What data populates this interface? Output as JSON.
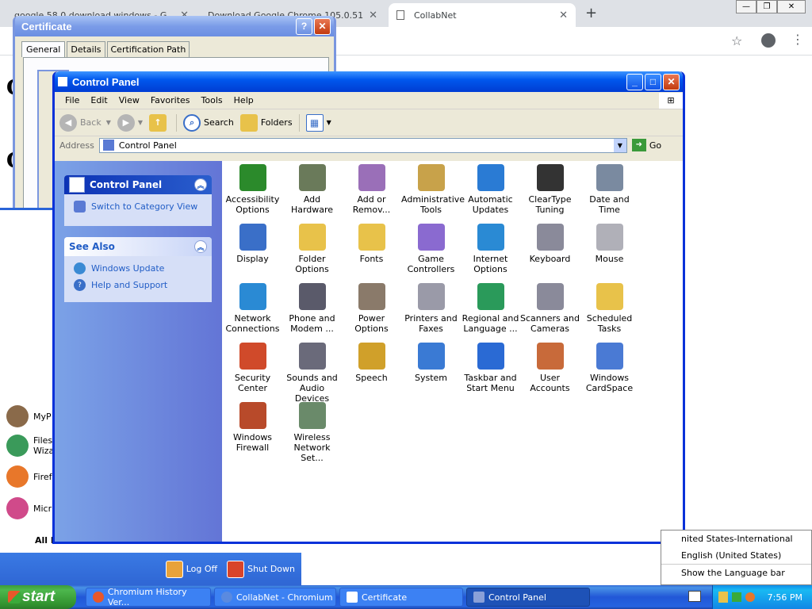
{
  "chrome": {
    "tabs": [
      {
        "label": "google 58.0 download windows - G"
      },
      {
        "label": "Download Google Chrome 105.0.51"
      },
      {
        "label": "CollabNet"
      }
    ],
    "new_tab": "+",
    "window_controls": [
      "—",
      "❐",
      "✕"
    ]
  },
  "certificate_window": {
    "title": "Certificate",
    "tabs": [
      "General",
      "Details",
      "Certification Path"
    ]
  },
  "control_panel": {
    "title": "Control Panel",
    "menu": [
      "File",
      "Edit",
      "View",
      "Favorites",
      "Tools",
      "Help"
    ],
    "toolbar": {
      "back": "Back",
      "search": "Search",
      "folders": "Folders"
    },
    "address_label": "Address",
    "address_value": "Control Panel",
    "go_label": "Go",
    "task_pane": {
      "panel_title": "Control Panel",
      "switch_link": "Switch to Category View",
      "see_also_title": "See Also",
      "see_also_links": [
        "Windows Update",
        "Help and Support"
      ]
    },
    "items": [
      {
        "line1": "Accessibility",
        "line2": "Options",
        "icon": "accessibility-icon",
        "color": "#2b8a2b"
      },
      {
        "line1": "Add Hardware",
        "line2": "",
        "icon": "add-hardware-icon",
        "color": "#6a7a5a"
      },
      {
        "line1": "Add or",
        "line2": "Remov...",
        "icon": "add-remove-icon",
        "color": "#9a6fb8"
      },
      {
        "line1": "Administrative",
        "line2": "Tools",
        "icon": "admin-tools-icon",
        "color": "#c8a24a"
      },
      {
        "line1": "Automatic",
        "line2": "Updates",
        "icon": "automatic-updates-icon",
        "color": "#2a7bd4"
      },
      {
        "line1": "ClearType",
        "line2": "Tuning",
        "icon": "cleartype-icon",
        "color": "#333333"
      },
      {
        "line1": "Date and Time",
        "line2": "",
        "icon": "clock-icon",
        "color": "#7a8aa0"
      },
      {
        "line1": "Display",
        "line2": "",
        "icon": "display-icon",
        "color": "#3a6fc8"
      },
      {
        "line1": "Folder Options",
        "line2": "",
        "icon": "folder-options-icon",
        "color": "#e8c24a"
      },
      {
        "line1": "Fonts",
        "line2": "",
        "icon": "fonts-folder-icon",
        "color": "#e8c24a"
      },
      {
        "line1": "Game",
        "line2": "Controllers",
        "icon": "gamepad-icon",
        "color": "#8a6ad0"
      },
      {
        "line1": "Internet",
        "line2": "Options",
        "icon": "internet-options-icon",
        "color": "#2a8ad4"
      },
      {
        "line1": "Keyboard",
        "line2": "",
        "icon": "keyboard-icon",
        "color": "#8a8a9a"
      },
      {
        "line1": "Mouse",
        "line2": "",
        "icon": "mouse-icon",
        "color": "#b0b0b8"
      },
      {
        "line1": "Network",
        "line2": "Connections",
        "icon": "network-icon",
        "color": "#2a8ad4"
      },
      {
        "line1": "Phone and",
        "line2": "Modem ...",
        "icon": "phone-icon",
        "color": "#5a5a6a"
      },
      {
        "line1": "Power Options",
        "line2": "",
        "icon": "power-icon",
        "color": "#8a7a6a"
      },
      {
        "line1": "Printers and",
        "line2": "Faxes",
        "icon": "printer-icon",
        "color": "#9a9aa8"
      },
      {
        "line1": "Regional and",
        "line2": "Language ...",
        "icon": "globe-icon",
        "color": "#2a9a5a"
      },
      {
        "line1": "Scanners and",
        "line2": "Cameras",
        "icon": "scanner-icon",
        "color": "#8a8a9a"
      },
      {
        "line1": "Scheduled",
        "line2": "Tasks",
        "icon": "scheduled-tasks-icon",
        "color": "#e8c24a"
      },
      {
        "line1": "Security",
        "line2": "Center",
        "icon": "shield-icon",
        "color": "#d04a2a"
      },
      {
        "line1": "Sounds and",
        "line2": "Audio Devices",
        "icon": "speaker-icon",
        "color": "#6a6a7a"
      },
      {
        "line1": "Speech",
        "line2": "",
        "icon": "speech-icon",
        "color": "#d0a02a"
      },
      {
        "line1": "System",
        "line2": "",
        "icon": "system-icon",
        "color": "#3a7ad4"
      },
      {
        "line1": "Taskbar and",
        "line2": "Start Menu",
        "icon": "taskbar-icon",
        "color": "#2a6ad4"
      },
      {
        "line1": "User Accounts",
        "line2": "",
        "icon": "user-accounts-icon",
        "color": "#c86a3a"
      },
      {
        "line1": "Windows",
        "line2": "CardSpace",
        "icon": "cardspace-icon",
        "color": "#4a7ad4"
      },
      {
        "line1": "Windows",
        "line2": "Firewall",
        "icon": "firewall-icon",
        "color": "#b84a2a"
      },
      {
        "line1": "Wireless",
        "line2": "Network Set...",
        "icon": "wireless-icon",
        "color": "#6a8a6a"
      }
    ]
  },
  "start_menu": {
    "items": [
      "MyP",
      "Files",
      "Wiza",
      "Firef",
      "Micr"
    ],
    "all_programs": "All P",
    "log_off": "Log Off",
    "shut_down": "Shut Down"
  },
  "language_menu": {
    "items": [
      "nited States-International",
      "English (United States)",
      "Show the Language bar"
    ]
  },
  "taskbar": {
    "start_label": "start",
    "tasks": [
      "Chromium History Ver...",
      "CollabNet - Chromium",
      "Certificate",
      "Control Panel"
    ],
    "clock": "7:56 PM"
  }
}
